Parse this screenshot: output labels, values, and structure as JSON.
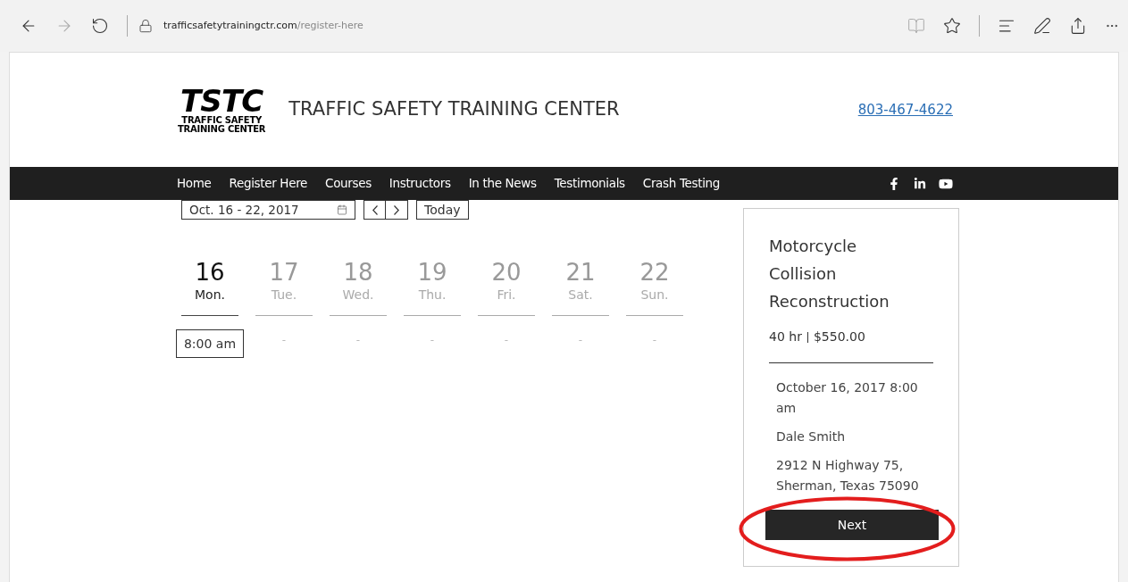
{
  "browser": {
    "url_domain": "trafficsafetytrainingctr.com",
    "url_path": "/register-here"
  },
  "header": {
    "logo_big": "TSTC",
    "logo_line1": "TRAFFIC SAFETY",
    "logo_line2": "TRAINING CENTER",
    "site_title": "TRAFFIC SAFETY TRAINING CENTER",
    "phone": "803-467-4622"
  },
  "nav": {
    "items": [
      "Home",
      "Register Here",
      "Courses",
      "Instructors",
      "In the News",
      "Testimonials",
      "Crash Testing"
    ]
  },
  "calendar": {
    "range": "Oct. 16 - 22, 2017",
    "today_button": "Today",
    "days": [
      {
        "number": "16",
        "weekday": "Mon.",
        "selected": true,
        "slot": {
          "kind": "time",
          "text": "8:00 am"
        }
      },
      {
        "number": "17",
        "weekday": "Tue.",
        "selected": false,
        "slot": {
          "kind": "empty",
          "text": "-"
        }
      },
      {
        "number": "18",
        "weekday": "Wed.",
        "selected": false,
        "slot": {
          "kind": "empty",
          "text": "-"
        }
      },
      {
        "number": "19",
        "weekday": "Thu.",
        "selected": false,
        "slot": {
          "kind": "empty",
          "text": "-"
        }
      },
      {
        "number": "20",
        "weekday": "Fri.",
        "selected": false,
        "slot": {
          "kind": "empty",
          "text": "-"
        }
      },
      {
        "number": "21",
        "weekday": "Sat.",
        "selected": false,
        "slot": {
          "kind": "empty",
          "text": "-"
        }
      },
      {
        "number": "22",
        "weekday": "Sun.",
        "selected": false,
        "slot": {
          "kind": "empty",
          "text": "-"
        }
      }
    ]
  },
  "course_card": {
    "title": "Motorcycle Collision Reconstruction",
    "duration": "40 hr",
    "price": "$550.00",
    "datetime": "October 16, 2017 8:00 am",
    "instructor": "Dale Smith",
    "address": "2912 N Highway 75, Sherman, Texas 75090",
    "button": "Next"
  }
}
